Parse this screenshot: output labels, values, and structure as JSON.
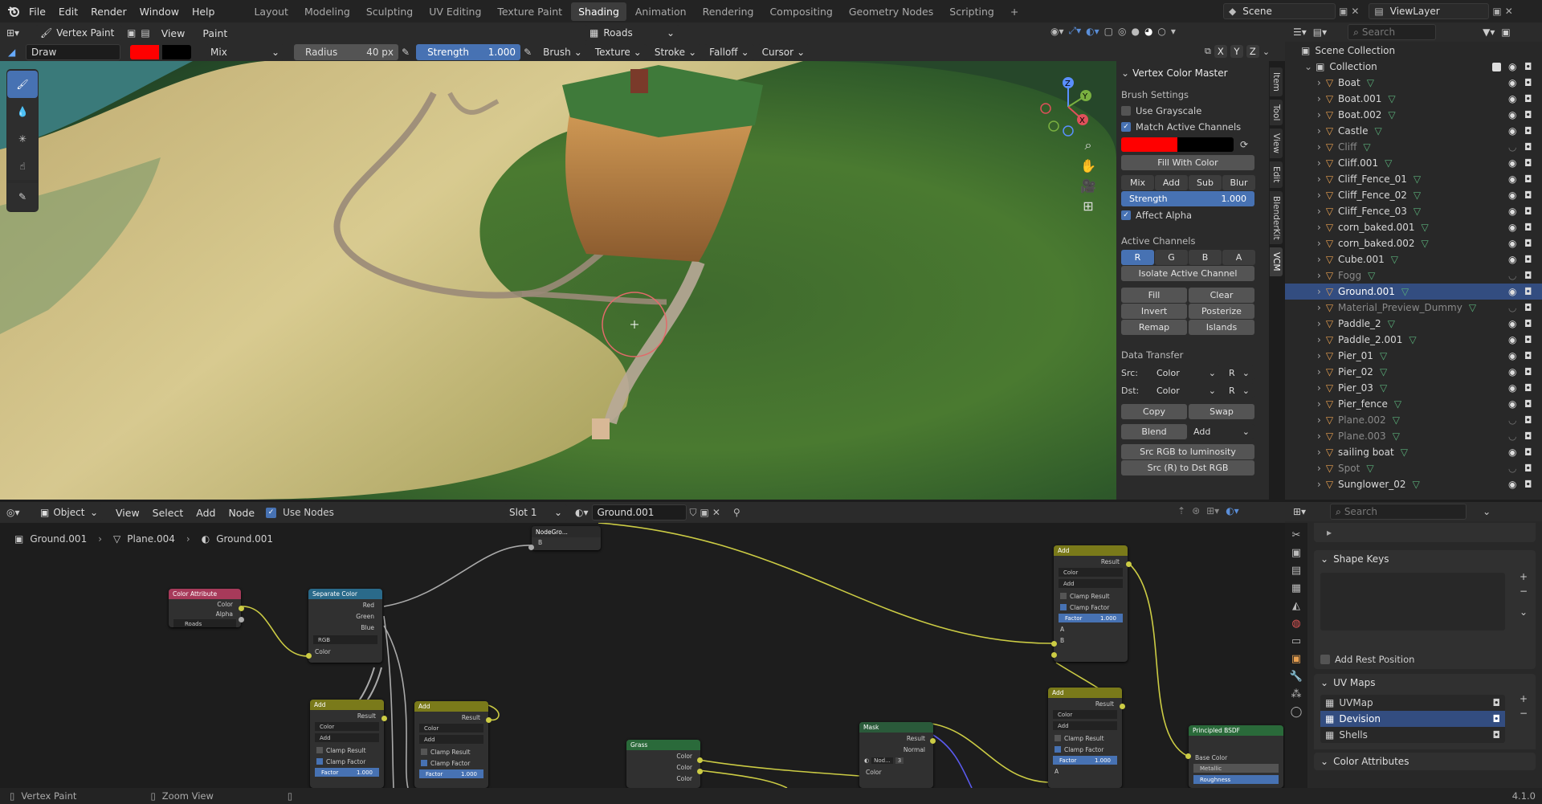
{
  "menu": {
    "file": "File",
    "edit": "Edit",
    "render": "Render",
    "window": "Window",
    "help": "Help"
  },
  "workspaces": [
    "Layout",
    "Modeling",
    "Sculpting",
    "UV Editing",
    "Texture Paint",
    "Shading",
    "Animation",
    "Rendering",
    "Compositing",
    "Geometry Nodes",
    "Scripting"
  ],
  "active_workspace": "Shading",
  "scene": {
    "name": "Scene",
    "view_layer": "ViewLayer"
  },
  "viewport": {
    "mode": "Vertex Paint",
    "view": "View",
    "paint": "Paint",
    "attribute": "Roads",
    "brush_name": "Draw",
    "blend": "Mix",
    "radius_label": "Radius",
    "radius_value": "40 px",
    "strength_label": "Strength",
    "strength_value": "1.000",
    "strength_fraction": 1.0,
    "brush": "Brush",
    "texture": "Texture",
    "stroke": "Stroke",
    "falloff": "Falloff",
    "cursor": "Cursor",
    "axes": {
      "x": "X",
      "y": "Y",
      "z": "Z"
    },
    "primary_color": "#ff0000",
    "secondary_color": "#000000"
  },
  "tabs": [
    "Item",
    "Tool",
    "View",
    "Edit",
    "BlenderKit",
    "VCM"
  ],
  "vcm": {
    "title": "Vertex Color Master",
    "brush_settings": "Brush Settings",
    "use_grayscale": "Use Grayscale",
    "match_active": "Match Active Channels",
    "fill_with_color": "Fill With Color",
    "blend_modes": [
      "Mix",
      "Add",
      "Sub",
      "Blur"
    ],
    "strength_label": "Strength",
    "strength_value": "1.000",
    "affect_alpha": "Affect Alpha",
    "active_channels": "Active Channels",
    "channels": [
      "R",
      "G",
      "B",
      "A"
    ],
    "isolate": "Isolate Active Channel",
    "ops": [
      [
        "Fill",
        "Clear"
      ],
      [
        "Invert",
        "Posterize"
      ],
      [
        "Remap",
        "Islands"
      ]
    ],
    "data_transfer": "Data Transfer",
    "src_label": "Src:",
    "dst_label": "Dst:",
    "src_value": "Color",
    "src_channel": "R",
    "dst_value": "Color",
    "dst_channel": "R",
    "copy": "Copy",
    "swap": "Swap",
    "blend": "Blend",
    "blend_mode": "Add",
    "src_rgb_lum": "Src RGB to luminosity",
    "src_r_dst_rgb": "Src (R) to Dst RGB"
  },
  "outliner": {
    "search_placeholder": "Search",
    "scene_collection": "Scene Collection",
    "collection": "Collection",
    "items": [
      {
        "name": "Boat",
        "dim": false,
        "sel": false
      },
      {
        "name": "Boat.001",
        "dim": false,
        "sel": false
      },
      {
        "name": "Boat.002",
        "dim": false,
        "sel": false
      },
      {
        "name": "Castle",
        "dim": false,
        "sel": false
      },
      {
        "name": "Cliff",
        "dim": true,
        "sel": false
      },
      {
        "name": "Cliff.001",
        "dim": false,
        "sel": false
      },
      {
        "name": "Cliff_Fence_01",
        "dim": false,
        "sel": false
      },
      {
        "name": "Cliff_Fence_02",
        "dim": false,
        "sel": false
      },
      {
        "name": "Cliff_Fence_03",
        "dim": false,
        "sel": false
      },
      {
        "name": "corn_baked.001",
        "dim": false,
        "sel": false
      },
      {
        "name": "corn_baked.002",
        "dim": false,
        "sel": false
      },
      {
        "name": "Cube.001",
        "dim": false,
        "sel": false
      },
      {
        "name": "Fogg",
        "dim": true,
        "sel": false
      },
      {
        "name": "Ground.001",
        "dim": false,
        "sel": true
      },
      {
        "name": "Material_Preview_Dummy",
        "dim": true,
        "sel": false
      },
      {
        "name": "Paddle_2",
        "dim": false,
        "sel": false
      },
      {
        "name": "Paddle_2.001",
        "dim": false,
        "sel": false
      },
      {
        "name": "Pier_01",
        "dim": false,
        "sel": false
      },
      {
        "name": "Pier_02",
        "dim": false,
        "sel": false
      },
      {
        "name": "Pier_03",
        "dim": false,
        "sel": false
      },
      {
        "name": "Pier_fence",
        "dim": false,
        "sel": false
      },
      {
        "name": "Plane.002",
        "dim": true,
        "sel": false
      },
      {
        "name": "Plane.003",
        "dim": true,
        "sel": false
      },
      {
        "name": "sailing boat",
        "dim": false,
        "sel": false
      },
      {
        "name": "Spot",
        "dim": true,
        "sel": false
      },
      {
        "name": "Sunglower_02",
        "dim": false,
        "sel": false
      }
    ]
  },
  "node_editor": {
    "type": "Object",
    "view": "View",
    "select": "Select",
    "add": "Add",
    "node": "Node",
    "use_nodes": "Use Nodes",
    "slot": "Slot 1",
    "material": "Ground.001",
    "breadcrumb": [
      "Ground.001",
      "Plane.004",
      "Ground.001"
    ],
    "nodes": {
      "color_attribute": {
        "title": "Color Attribute",
        "out1": "Color",
        "out2": "Alpha",
        "attr": "Roads"
      },
      "separate_color": {
        "title": "Separate Color",
        "out1": "Red",
        "out2": "Green",
        "out3": "Blue",
        "mode": "RGB",
        "in1": "Color"
      },
      "node_group": {
        "title": "NodeGro...",
        "in1": "B"
      },
      "add1": {
        "title": "Add",
        "out": "Result",
        "type": "Color",
        "op": "Add",
        "clamp_result": "Clamp Result",
        "clamp_factor": "Clamp Factor",
        "factor": "Factor",
        "factor_value": "1.000"
      },
      "add2": {
        "title": "Add",
        "out": "Result",
        "type": "Color",
        "op": "Add",
        "clamp_result": "Clamp Result",
        "clamp_factor": "Clamp Factor",
        "factor": "Factor",
        "factor_value": "1.000"
      },
      "add3": {
        "title": "Add",
        "out": "Result",
        "type": "Color",
        "op": "Add",
        "clamp_result": "Clamp Result",
        "clamp_factor": "Clamp Factor",
        "factor": "Factor",
        "factor_value": "1.000",
        "a": "A",
        "b": "B"
      },
      "add4": {
        "title": "Add",
        "out": "Result",
        "type": "Color",
        "op": "Add",
        "clamp_result": "Clamp Result",
        "clamp_factor": "Clamp Factor",
        "factor": "Factor",
        "factor_value": "1.000",
        "a": "A"
      },
      "grass": {
        "title": "Grass",
        "out1": "Color",
        "out2": "Color",
        "out3": "Color"
      },
      "mask": {
        "title": "Mask",
        "out1": "Result",
        "out2": "Normal",
        "group": "Nod...",
        "users": "3",
        "in1": "Color"
      },
      "bsdf": {
        "title": "Principled BSDF",
        "in1": "Base Color",
        "in2": "Metallic",
        "in3": "Roughness"
      }
    }
  },
  "properties": {
    "search_placeholder": "Search",
    "shape_keys": "Shape Keys",
    "add_rest": "Add Rest Position",
    "uv_maps": "UV Maps",
    "uv_items": [
      "UVMap",
      "Devision",
      "Shells"
    ],
    "color_attributes": "Color Attributes"
  },
  "status": {
    "left": "Vertex Paint",
    "middle": "Zoom View",
    "version": "4.1.0"
  }
}
